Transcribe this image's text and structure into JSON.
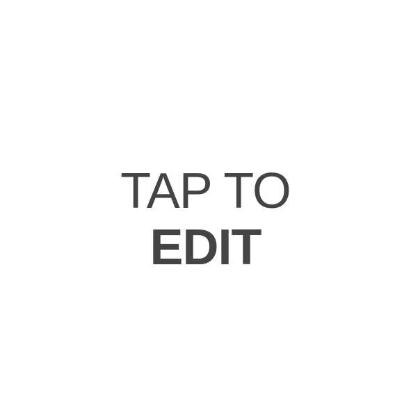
{
  "prompt": {
    "line1": "TAP TO",
    "line2": "EDIT"
  },
  "colors": {
    "background": "#ffffff",
    "text": "#444444"
  }
}
